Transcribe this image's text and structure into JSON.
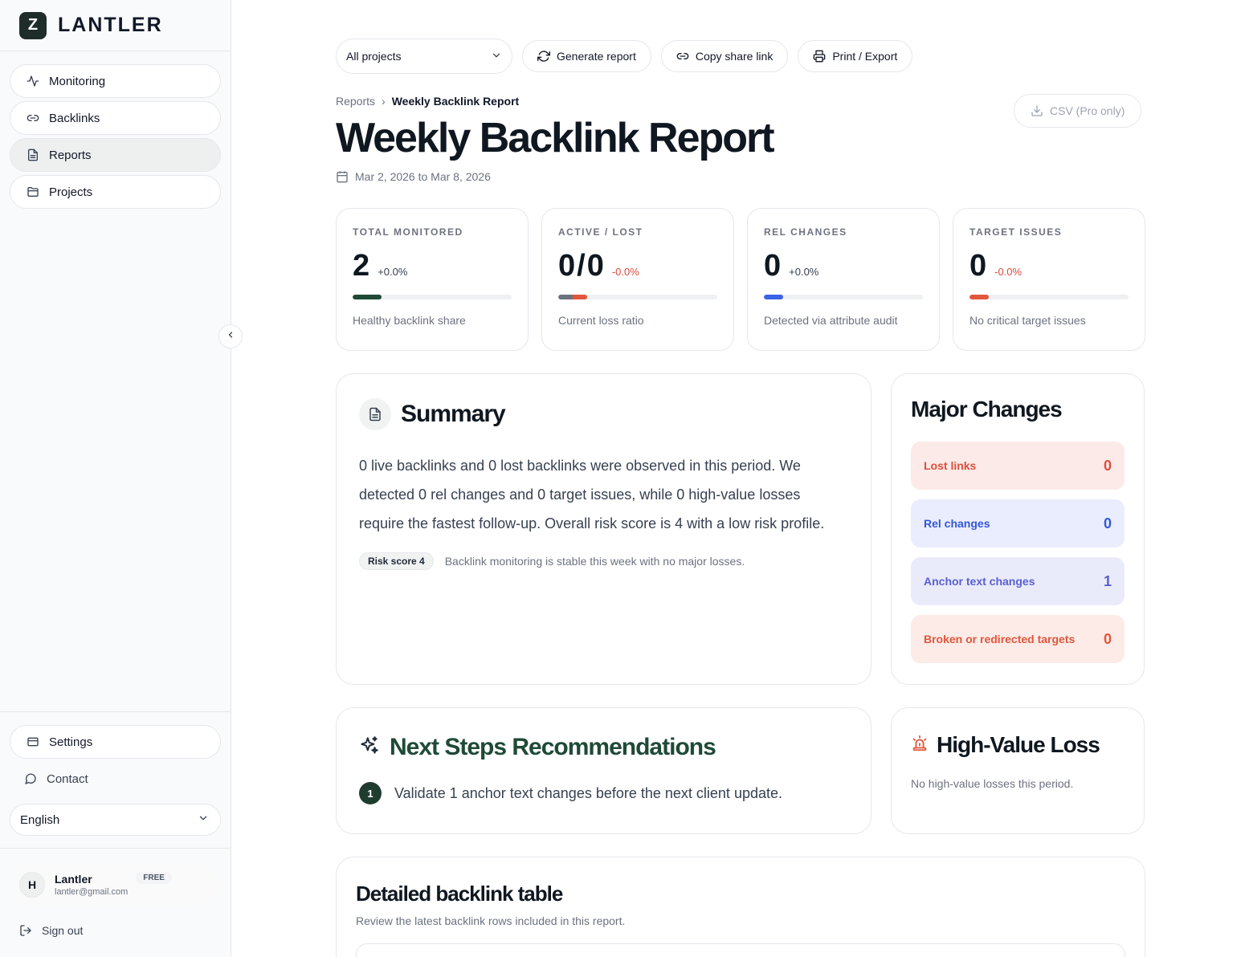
{
  "brand": {
    "name": "LANTLER",
    "logo_letter": "Z"
  },
  "sidebar": {
    "items": [
      {
        "label": "Monitoring",
        "icon": "activity-icon",
        "active": false
      },
      {
        "label": "Backlinks",
        "icon": "link-icon",
        "active": false
      },
      {
        "label": "Reports",
        "icon": "document-icon",
        "active": true
      },
      {
        "label": "Projects",
        "icon": "folder-icon",
        "active": false
      }
    ],
    "settings_label": "Settings",
    "contact_label": "Contact",
    "language": "English",
    "user": {
      "initial": "H",
      "name": "Lantler",
      "email": "lantler@gmail.com",
      "plan": "FREE"
    },
    "signout_label": "Sign out"
  },
  "toolbar": {
    "project_select": "All projects",
    "generate_label": "Generate report",
    "copy_link_label": "Copy share link",
    "print_label": "Print / Export",
    "csv_label": "CSV (Pro only)"
  },
  "breadcrumb": {
    "parent": "Reports",
    "separator": "›",
    "current": "Weekly Backlink Report"
  },
  "page": {
    "title": "Weekly Backlink Report",
    "date_range": "Mar 2, 2026 to Mar 8, 2026"
  },
  "stats": [
    {
      "label": "TOTAL MONITORED",
      "value": "2",
      "delta": "+0.0%",
      "negative": false,
      "fill_pct": 18,
      "fill_color": "#1f4a36",
      "sub": "Healthy backlink share"
    },
    {
      "label": "ACTIVE / LOST",
      "value": "0/0",
      "delta": "-0.0%",
      "negative": true,
      "fill_pct": 18,
      "fill_color": "gradient-gray-red",
      "sub": "Current loss ratio"
    },
    {
      "label": "REL CHANGES",
      "value": "0",
      "delta": "+0.0%",
      "negative": false,
      "fill_pct": 12,
      "fill_color": "#3b63e6",
      "sub": "Detected via attribute audit"
    },
    {
      "label": "TARGET ISSUES",
      "value": "0",
      "delta": "-0.0%",
      "negative": true,
      "fill_pct": 12,
      "fill_color": "#e0573d",
      "sub": "No critical target issues"
    }
  ],
  "summary": {
    "title": "Summary",
    "text": "0 live backlinks and 0 lost backlinks were observed in this period. We detected 0 rel changes and 0 target issues, while 0 high-value losses require the fastest follow-up. Overall risk score is 4 with a low risk profile.",
    "risk_badge": "Risk score 4",
    "risk_note": "Backlink monitoring is stable this week with no major losses."
  },
  "major_changes": {
    "title": "Major Changes",
    "items": [
      {
        "label": "Lost links",
        "count": "0",
        "tone": "c-red"
      },
      {
        "label": "Rel changes",
        "count": "0",
        "tone": "c-blue"
      },
      {
        "label": "Anchor text changes",
        "count": "1",
        "tone": "c-purple"
      },
      {
        "label": "Broken or redirected targets",
        "count": "0",
        "tone": "c-orange"
      }
    ]
  },
  "next_steps": {
    "title": "Next Steps Recommendations",
    "items": [
      {
        "num": "1",
        "text": "Validate 1 anchor text changes before the next client update."
      }
    ]
  },
  "high_value_loss": {
    "title": "High-Value Loss",
    "text": "No high-value losses this period."
  },
  "detail_table": {
    "title": "Detailed backlink table",
    "subtitle": "Review the latest backlink rows included in this report."
  }
}
